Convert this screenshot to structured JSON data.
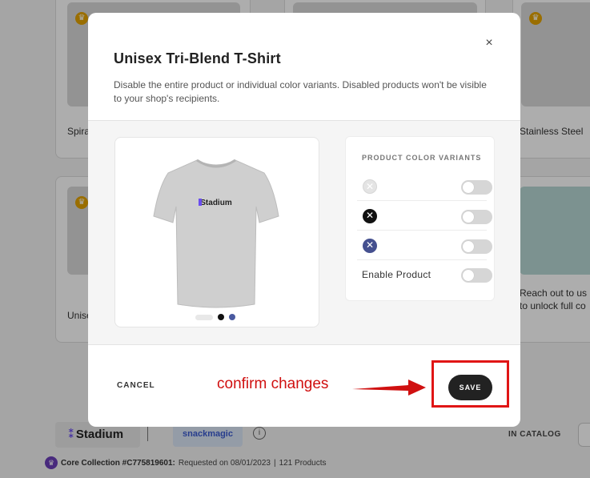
{
  "background": {
    "card_titles": [
      "Spira",
      "Stainless Steel",
      "Unise",
      "Reach out to us",
      "to unlock full co"
    ],
    "brand_stadium": "Stadium",
    "brand_snack": "snackmagic",
    "in_catalog": "IN CATALOG",
    "collection": {
      "name": "Core Collection #C775819601:",
      "requested": "Requested on 08/01/2023",
      "separator": "|",
      "products": "121 Products"
    }
  },
  "modal": {
    "close_glyph": "×",
    "title": "Unisex Tri-Blend T-Shirt",
    "description": "Disable the entire product or individual color variants. Disabled products won't be visible to your shop's recipients.",
    "product_image_logo": "Stadium",
    "variants_title": "PRODUCT COLOR VARIANTS",
    "variants": [
      {
        "color": "#e4e4e4",
        "enabled": false
      },
      {
        "color": "#111111",
        "enabled": false
      },
      {
        "color": "#45508f",
        "enabled": false
      }
    ],
    "enable_product_label": "Enable Product",
    "enable_product": false,
    "cancel_label": "CANCEL",
    "save_label": "SAVE"
  },
  "annotation": {
    "text": "confirm changes",
    "color": "#d01010"
  }
}
